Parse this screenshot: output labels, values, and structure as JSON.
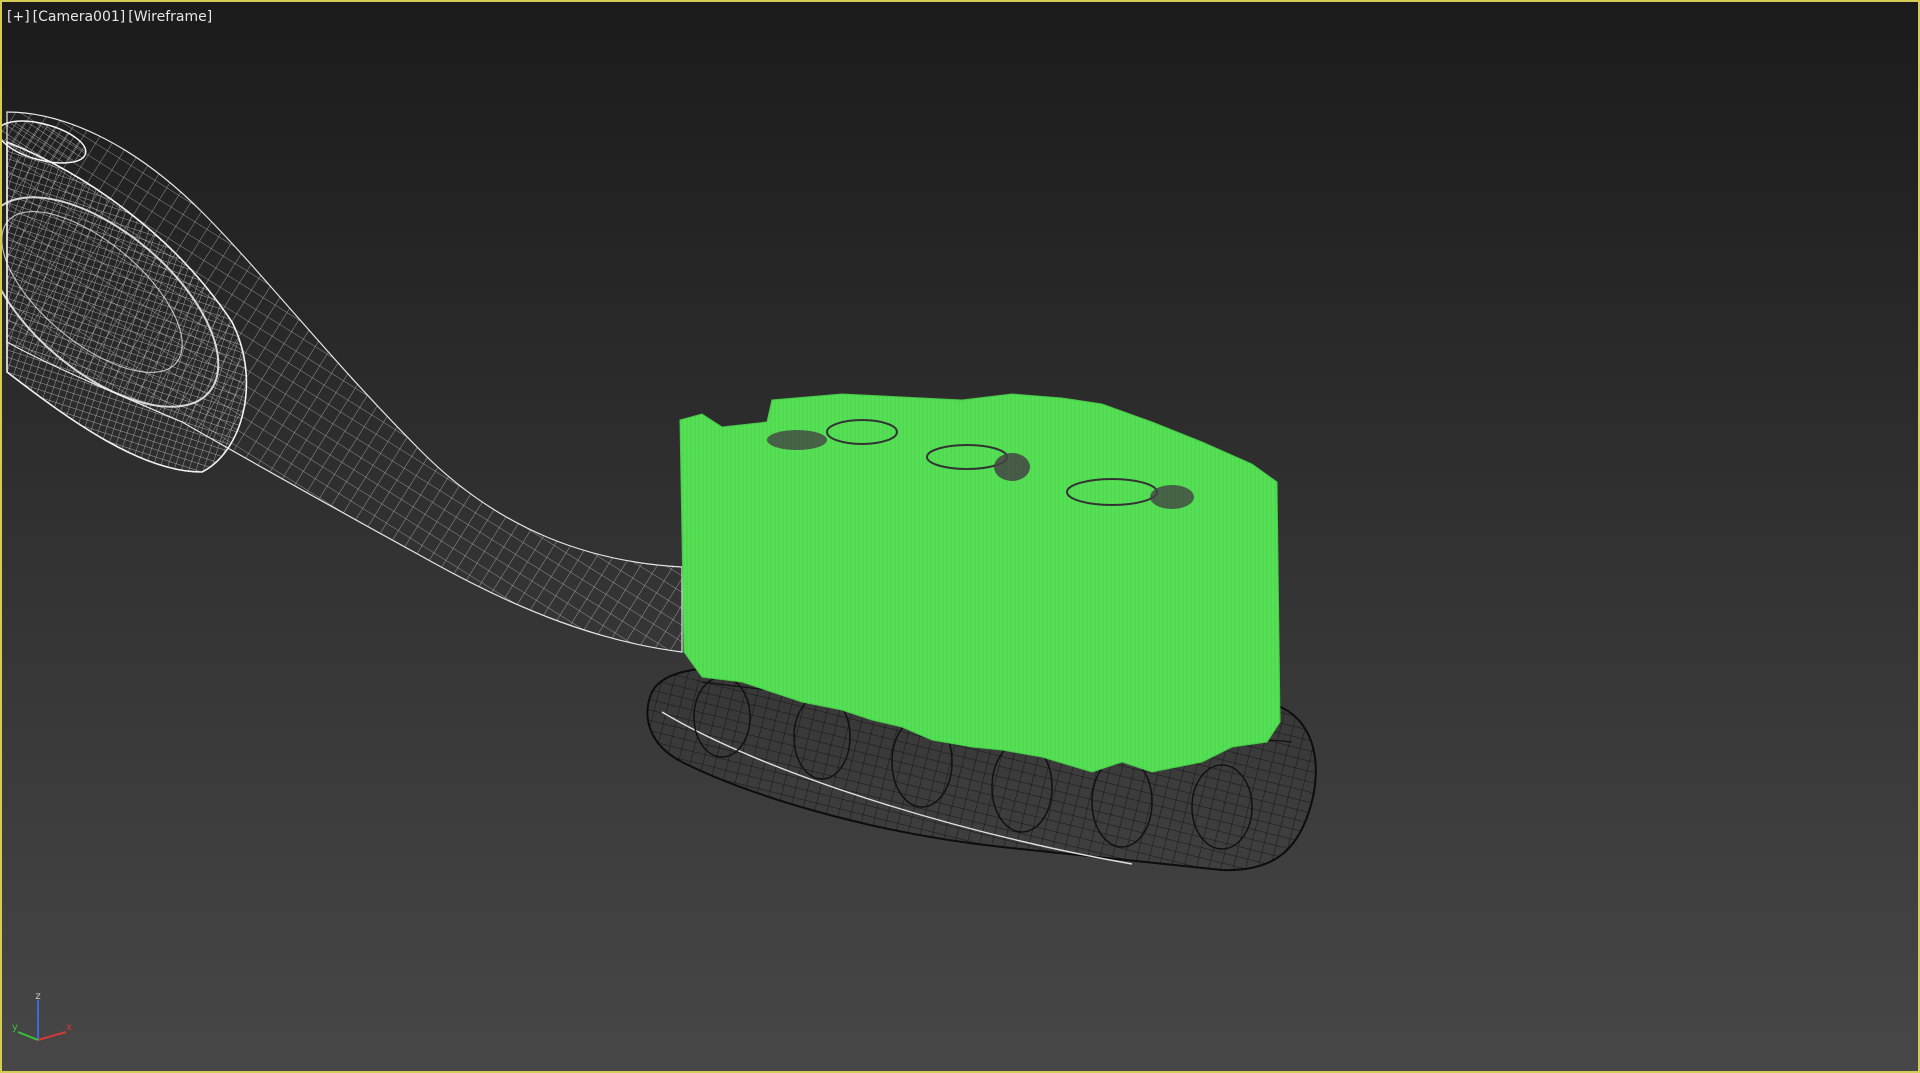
{
  "viewport": {
    "menu_label": "[+]",
    "camera_label": "[Camera001]",
    "shading_label": "[Wireframe]",
    "border_color": "#d4cc57",
    "background_top": "#1b1b1b",
    "background_bottom": "#474747"
  },
  "scene": {
    "objects": [
      {
        "name": "toothbrush-handle",
        "display": "wireframe",
        "color": "#e8e8e8"
      },
      {
        "name": "toothbrush-head",
        "display": "wireframe",
        "color": "#111111"
      },
      {
        "name": "bristle-tufts",
        "display": "solid",
        "color": "#52e052"
      }
    ]
  },
  "axis_gizmo": {
    "z_label": "z",
    "x_label": "x",
    "y_label": "y",
    "x_color": "#d23a3a",
    "y_color": "#3ac23a",
    "z_color": "#3a6ad6"
  }
}
